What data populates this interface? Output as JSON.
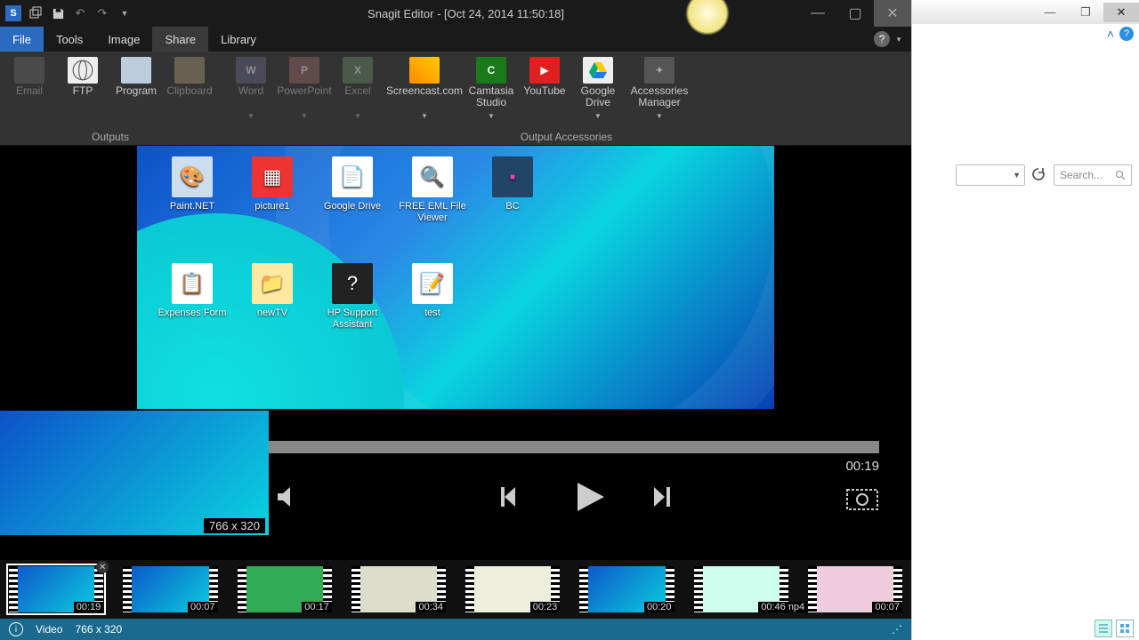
{
  "titlebar": {
    "title": "Snagit Editor - [Oct 24, 2014 11:50:18]"
  },
  "menu": {
    "file": "File",
    "tools": "Tools",
    "image": "Image",
    "share": "Share",
    "library": "Library"
  },
  "ribbon": {
    "outputs_label": "Outputs",
    "accessories_label": "Output Accessories",
    "email": "Email",
    "ftp": "FTP",
    "program": "Program",
    "clipboard": "Clipboard",
    "word": "Word",
    "powerpoint": "PowerPoint",
    "excel": "Excel",
    "screencast": "Screencast.com",
    "camtasia": "Camtasia Studio",
    "youtube": "YouTube",
    "gdrive": "Google Drive",
    "accmgr": "Accessories Manager"
  },
  "desktop_icons": [
    {
      "name": "Paint.NET"
    },
    {
      "name": "picture1"
    },
    {
      "name": "Google Drive"
    },
    {
      "name": "FREE EML File Viewer"
    },
    {
      "name": "BC"
    },
    {
      "name": "Expenses Form"
    },
    {
      "name": "newTV"
    },
    {
      "name": "HP Support Assistant"
    },
    {
      "name": "test"
    }
  ],
  "player": {
    "time": "00:19",
    "dimensions": "766 x 320"
  },
  "tray": [
    {
      "dur": "00:19",
      "sel": true
    },
    {
      "dur": "00:07"
    },
    {
      "dur": "00:17",
      "bg": "#3a5"
    },
    {
      "dur": "00:34",
      "bg": "#ddc"
    },
    {
      "dur": "00:23",
      "bg": "#eed"
    },
    {
      "dur": "00:20"
    },
    {
      "dur": "00:46",
      "bg": "#cfe"
    },
    {
      "dur": "00:07",
      "pre": "mp4",
      "bg": "#ecd"
    }
  ],
  "statusbar": {
    "type": "Video",
    "dims": "766 x 320"
  },
  "side": {
    "search_placeholder": "Search..."
  }
}
